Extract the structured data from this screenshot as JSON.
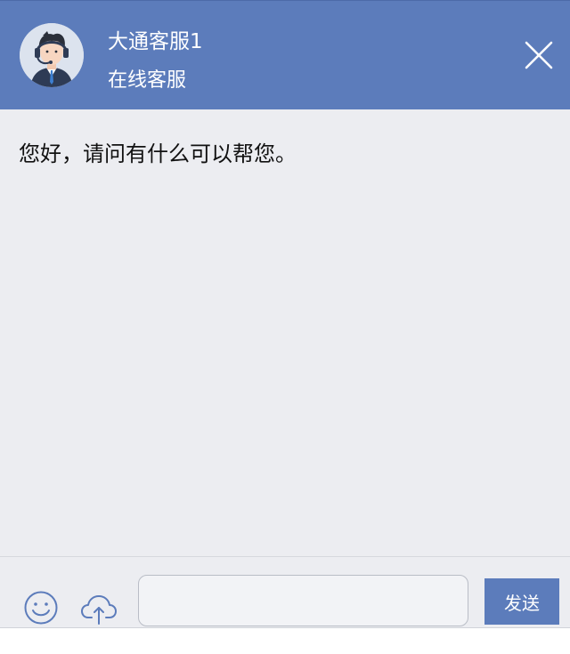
{
  "header": {
    "agent_name": "大通客服1",
    "agent_status": "在线客服"
  },
  "conversation": {
    "messages": [
      {
        "text": "您好，请问有什么可以帮您。"
      }
    ]
  },
  "composer": {
    "input_value": "",
    "input_placeholder": "",
    "send_label": "发送"
  },
  "icons": {
    "avatar": "customer-service-agent-avatar",
    "close": "close-icon",
    "emoji": "smiley-face-icon",
    "upload": "cloud-upload-icon"
  },
  "colors": {
    "header_bg": "#5C7CBB",
    "body_bg": "#ECEDF1",
    "send_bg": "#5C7CBB",
    "icon_stroke": "#5C7CBB"
  }
}
